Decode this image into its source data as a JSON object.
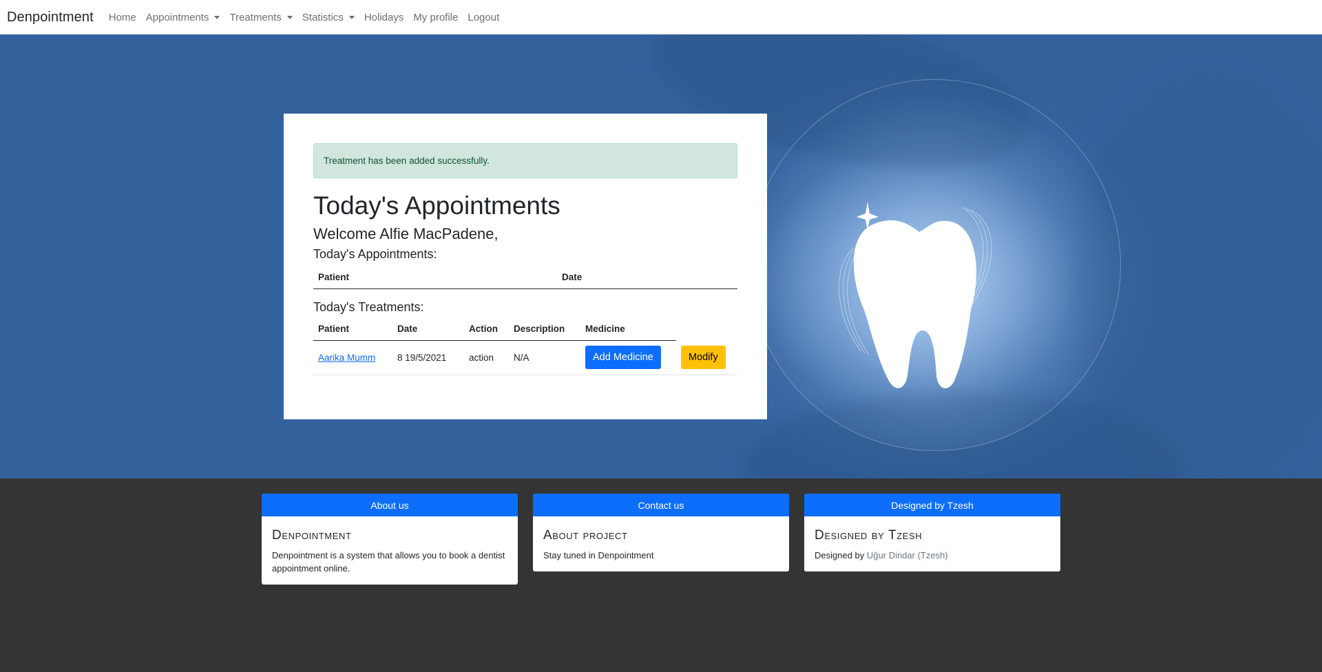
{
  "nav": {
    "brand": "Denpointment",
    "items": [
      {
        "label": "Home",
        "dropdown": false
      },
      {
        "label": "Appointments",
        "dropdown": true
      },
      {
        "label": "Treatments",
        "dropdown": true
      },
      {
        "label": "Statistics",
        "dropdown": true
      },
      {
        "label": "Holidays",
        "dropdown": false
      },
      {
        "label": "My profile",
        "dropdown": false
      },
      {
        "label": "Logout",
        "dropdown": false
      }
    ]
  },
  "main": {
    "alert": "Treatment has been added successfully.",
    "title": "Today's Appointments",
    "welcome": "Welcome Alfie MacPadene,",
    "appointments_heading": "Today's Appointments:",
    "appointments_columns": [
      "Patient",
      "Date"
    ],
    "treatments_heading": "Today's Treatments:",
    "treatments_columns": [
      "Patient",
      "Date",
      "Action",
      "Description",
      "Medicine"
    ],
    "treatments_rows": [
      {
        "patient": "Aarika Mumm",
        "date": "8 19/5/2021",
        "action": "action",
        "description": "N/A",
        "add_medicine_label": "Add Medicine",
        "modify_label": "Modify"
      }
    ]
  },
  "footer": {
    "cards": [
      {
        "header": "About us",
        "title": "Denpointment",
        "text": "Denpointment is a system that allows you to book a dentist appointment online."
      },
      {
        "header": "Contact us",
        "title": "About project",
        "text": "Stay tuned in Denpointment"
      },
      {
        "header": "Designed by Tzesh",
        "title": "Designed by Tzesh",
        "text_prefix": "Designed by",
        "author": "Uğur Dindar (Tzesh)"
      }
    ]
  },
  "colors": {
    "primary": "#0d6efd",
    "warning": "#ffc107",
    "alert_bg": "#d1e7dd",
    "footer_bg": "#343434",
    "hero_blue": "#33619c"
  },
  "icons": {
    "hero": "tooth-icon",
    "dropdown": "caret-down-icon"
  }
}
